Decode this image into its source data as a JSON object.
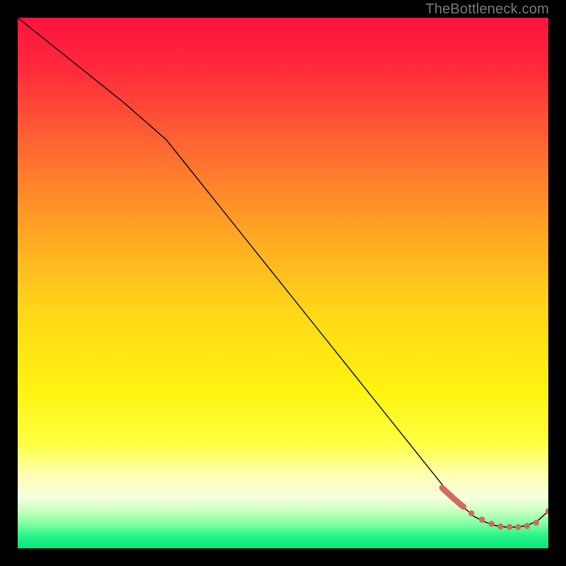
{
  "watermark": "TheBottleneck.com",
  "chart_data": {
    "type": "line",
    "title": "",
    "xlabel": "",
    "ylabel": "",
    "xlim": [
      0,
      100
    ],
    "ylim": [
      0,
      100
    ],
    "grid": false,
    "legend": false,
    "background_gradient": {
      "stops": [
        {
          "offset": 0.0,
          "color": "#ff123f"
        },
        {
          "offset": 0.1,
          "color": "#ff2b3b"
        },
        {
          "offset": 0.25,
          "color": "#ff6a32"
        },
        {
          "offset": 0.4,
          "color": "#ffa424"
        },
        {
          "offset": 0.55,
          "color": "#ffd618"
        },
        {
          "offset": 0.7,
          "color": "#fff310"
        },
        {
          "offset": 0.8,
          "color": "#ffff40"
        },
        {
          "offset": 0.86,
          "color": "#ffffb0"
        },
        {
          "offset": 0.905,
          "color": "#f5ffe0"
        },
        {
          "offset": 0.93,
          "color": "#c8ffc0"
        },
        {
          "offset": 0.955,
          "color": "#7effa0"
        },
        {
          "offset": 0.975,
          "color": "#2cf58a"
        },
        {
          "offset": 1.0,
          "color": "#05e57c"
        }
      ]
    },
    "series": [
      {
        "name": "bottleneck-curve",
        "color": "#000000",
        "stroke_width": 1.4,
        "x": [
          0,
          10,
          20,
          28,
          36,
          44,
          52,
          60,
          68,
          76,
          82,
          86,
          88,
          90,
          92,
          94,
          96,
          98,
          100
        ],
        "y": [
          100,
          92,
          84,
          77,
          67,
          57,
          47,
          37,
          27,
          17,
          9.5,
          6.0,
          5.0,
          4.3,
          4.0,
          4.0,
          4.3,
          5.2,
          7.0
        ]
      }
    ],
    "markers": {
      "name": "highlight-dots",
      "color": "#d46a5e",
      "radius": 4.2,
      "x": [
        80,
        81.7,
        83.3,
        85.5,
        87.5,
        89.3,
        91.0,
        92.7,
        94.3,
        96.0,
        97.7,
        100
      ],
      "y": [
        11.4,
        9.8,
        8.4,
        6.6,
        5.4,
        4.6,
        4.1,
        4.0,
        4.0,
        4.2,
        4.8,
        7.0
      ],
      "dense_segment": {
        "x_start": 80,
        "x_end": 84,
        "thick": true
      }
    }
  }
}
